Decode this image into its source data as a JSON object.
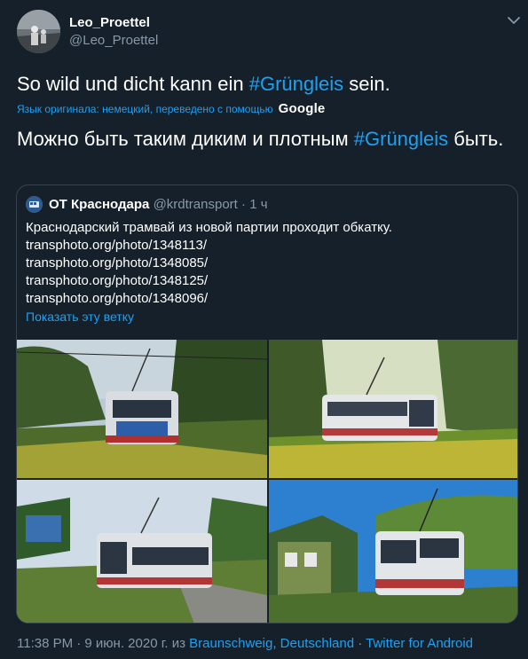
{
  "tweet": {
    "user_name": "Leo_Proettel",
    "user_handle": "@Leo_Proettel",
    "text_before": "So wild und dicht kann ein ",
    "hashtag": "#Grüngleis",
    "text_after": " sein.",
    "translate_note": "Язык оригинала: немецкий, переведено с помощью",
    "translate_brand": "Google",
    "translated_before": "Можно быть таким диким и плотным ",
    "translated_hashtag": "#Grüngleis",
    "translated_after": " быть."
  },
  "quote": {
    "name": "ОТ Краснодара",
    "handle": "@krdtransport",
    "separator": "·",
    "time": "1 ч",
    "lines": [
      "Краснодарский трамвай из новой партии проходит обкатку.",
      "transphoto.org/photo/1348113/",
      "transphoto.org/photo/1348085/",
      "transphoto.org/photo/1348125/",
      "transphoto.org/photo/1348096/"
    ],
    "show_thread": "Показать эту ветку"
  },
  "footer": {
    "timestamp": "11:38 PM · 9 июн. 2020 г. из ",
    "location": "Braunschweig, Deutschland",
    "separator": " · ",
    "source": "Twitter for Android"
  },
  "colors": {
    "background": "#15202b",
    "accent": "#1da1f2",
    "secondary_text": "#8899a6",
    "border": "#38444d"
  },
  "icons": [
    "avatar",
    "chevron-down-icon",
    "quote-avatar"
  ]
}
